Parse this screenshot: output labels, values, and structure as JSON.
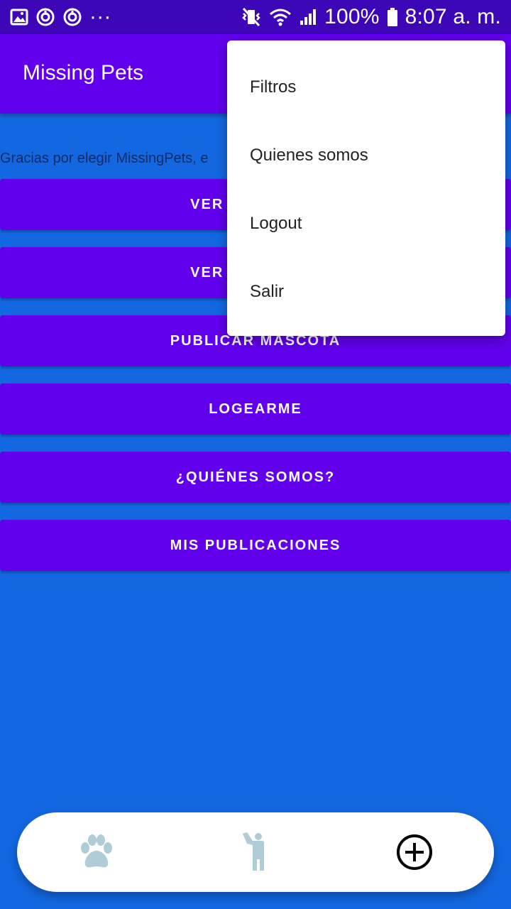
{
  "status_bar": {
    "battery_percent": "100%",
    "time": "8:07 a. m.",
    "overflow_dots": "···"
  },
  "app_bar": {
    "title": "Missing Pets"
  },
  "main": {
    "intro_text": "Gracias por elegir MissingPets, e",
    "buttons": [
      {
        "label": "VER MASCOTAS"
      },
      {
        "label": "VER MASCOTAS"
      },
      {
        "label": "PUBLICAR MASCOTA"
      },
      {
        "label": "LOGEARME"
      },
      {
        "label": "¿QUIÉNES SOMOS?"
      },
      {
        "label": "MIS PUBLICACIONES"
      }
    ]
  },
  "menu": {
    "items": [
      {
        "label": "Filtros"
      },
      {
        "label": "Quienes somos"
      },
      {
        "label": "Logout"
      },
      {
        "label": "Salir"
      }
    ]
  },
  "bottom_nav": {
    "items": [
      {
        "icon": "paw-icon",
        "color": "#B0CCD6"
      },
      {
        "icon": "person-icon",
        "color": "#B0CCD6"
      },
      {
        "icon": "add-circle-icon",
        "color": "#000000"
      }
    ]
  },
  "colors": {
    "status_bar": "#3D07B8",
    "primary": "#6200EE",
    "background": "#1368E2",
    "menu_bg": "#FFFFFF",
    "nav_bg": "#FFFFFF"
  }
}
